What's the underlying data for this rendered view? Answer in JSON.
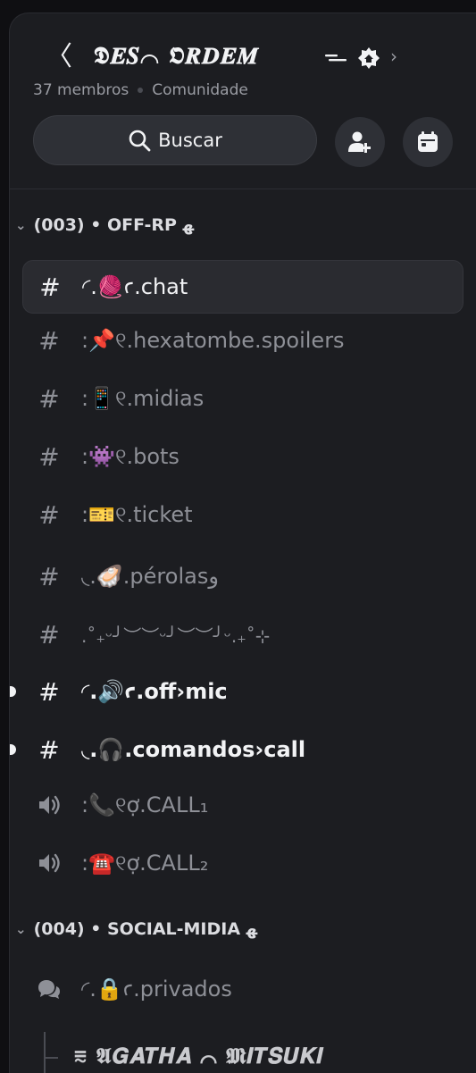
{
  "header": {
    "back": "〈",
    "server_name": "𝕯𝑬𝑺⌒ 𝕺𝑹𝑫𝑬𝑴",
    "members": "37 membros",
    "community": "Comunidade",
    "search_label": "Buscar",
    "chevron": "›"
  },
  "categories": [
    {
      "label": "(003) • OFF-RP ﻬ",
      "caret": "⌄"
    },
    {
      "label": "(004) • SOCIAL-MIDIA ﻬ",
      "caret": "⌄"
    }
  ],
  "channels": [
    {
      "icon": "#",
      "name": "◜.🧶ꜥ.chat"
    },
    {
      "icon": "#",
      "name": ":📌୧.hexatombe.spoilers"
    },
    {
      "icon": "#",
      "name": ":📱୧.midias"
    },
    {
      "icon": "#",
      "name": ":👾୧.bots"
    },
    {
      "icon": "#",
      "name": ":🎫୧.ticket"
    },
    {
      "icon": "#",
      "name": "◟.🦪.pérolasﻭ"
    },
    {
      "icon": "#",
      "name": ".˚₊ᵕ╯︶︶ᵕ╯︶︶╯ᵕ.₊˚⊹"
    },
    {
      "icon": "#",
      "name": "◜.🔊ꜥ.off›mic"
    },
    {
      "icon": "#",
      "name": "◟.🎧.comandos›call"
    },
    {
      "name": ":📞୧ợ.CALL₁"
    },
    {
      "name": ":☎️୧ợ.CALL₂"
    },
    {
      "name": "◜.🔒ꜥ.privados"
    }
  ],
  "thread": {
    "name": "⩳ 𝕬𝑮𝑨𝑻𝑯𝑨 ⌒ 𝕸𝑰𝑻𝑺𝑼𝑲𝑰"
  }
}
